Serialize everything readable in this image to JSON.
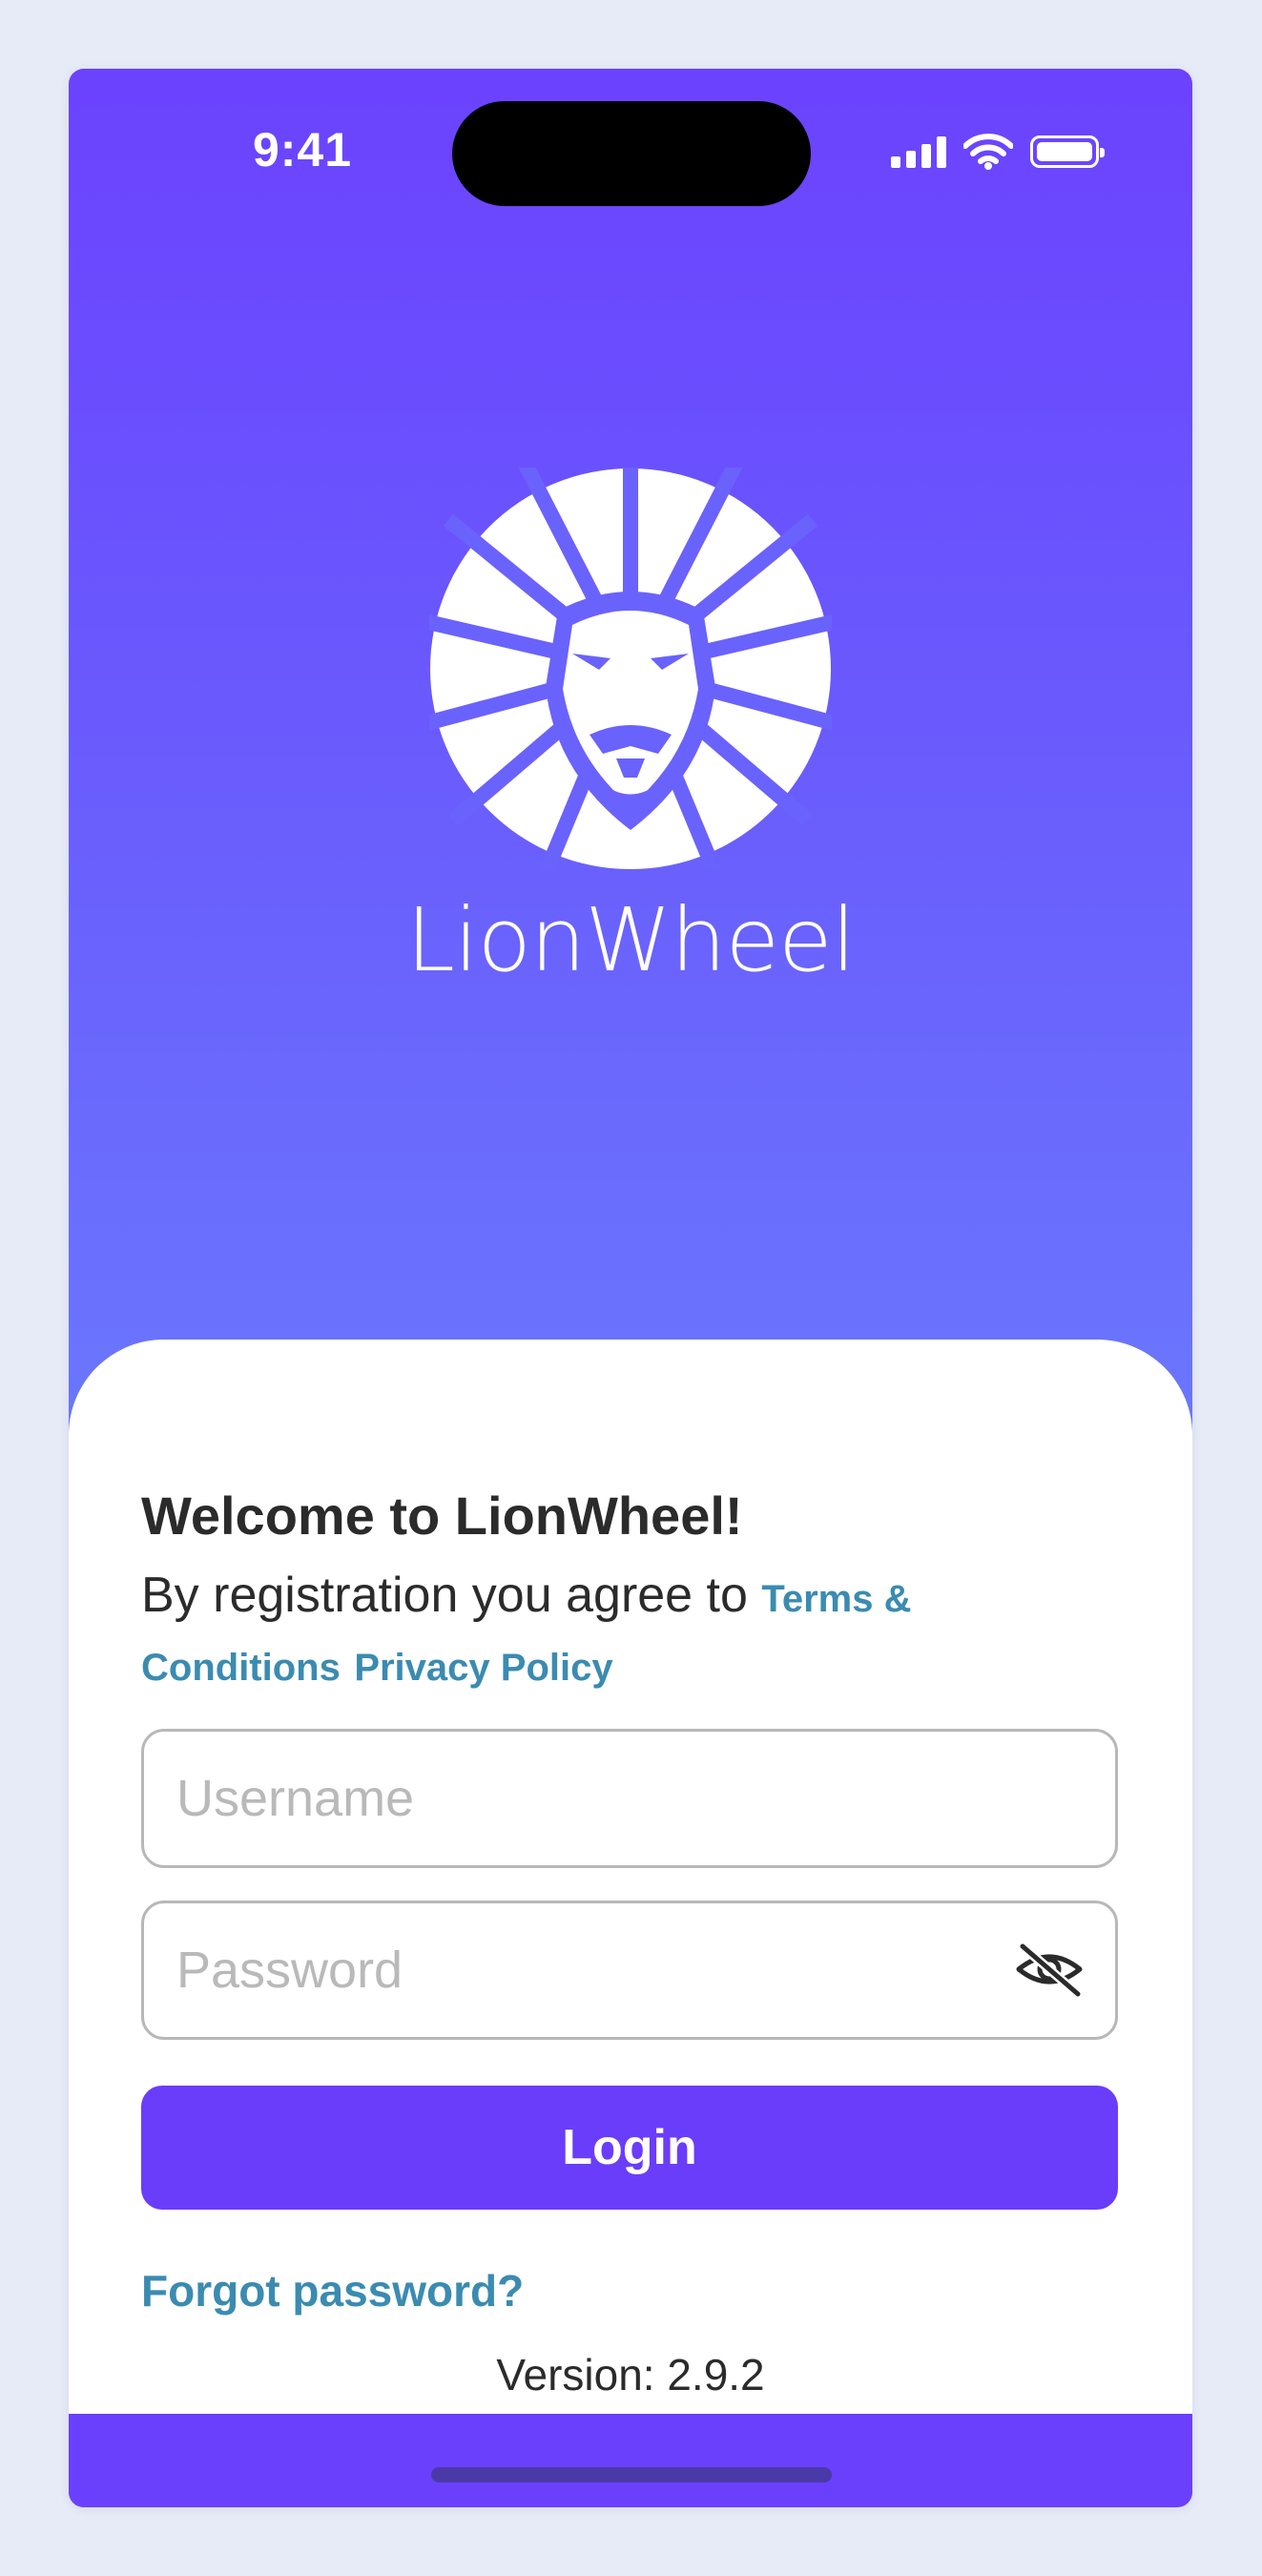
{
  "status_bar": {
    "time": "9:41"
  },
  "brand": {
    "name": "LionWheel",
    "primary_color": "#6a3dfb",
    "link_color": "#3b8bb1"
  },
  "login": {
    "welcome": "Welcome to LionWheel!",
    "agree_text": "By registration you agree to",
    "terms_link": "Terms & Conditions",
    "privacy_link": "Privacy Policy",
    "username_placeholder": "Username",
    "password_placeholder": "Password",
    "password_toggle_icon": "eye-slash-icon",
    "login_label": "Login",
    "forgot_label": "Forgot password?",
    "version": "Version: 2.9.2"
  }
}
